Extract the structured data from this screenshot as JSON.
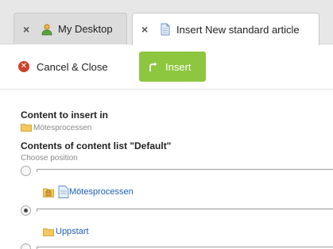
{
  "tabs": [
    {
      "label": "My Desktop",
      "icon": "person-icon",
      "active": false
    },
    {
      "label": "Insert New standard article",
      "icon": "page-icon",
      "active": true
    }
  ],
  "toolbar": {
    "cancel_label": "Cancel & Close",
    "insert_label": "Insert",
    "insert_color": "#8dc63f",
    "cancel_icon_color": "#c8432a"
  },
  "form": {
    "content_heading": "Content to insert in",
    "content_folder": "Mötesprocessen",
    "list_heading": "Contents of content list \"Default\"",
    "choose_position": "Choose position",
    "items": [
      {
        "label": "Mötesprocessen",
        "locked": true
      },
      {
        "label": "Uppstart",
        "locked": false
      }
    ],
    "selected_position_index": 1
  },
  "colors": {
    "link": "#1a5fb4",
    "tabstrip": "#e7e7e7"
  }
}
